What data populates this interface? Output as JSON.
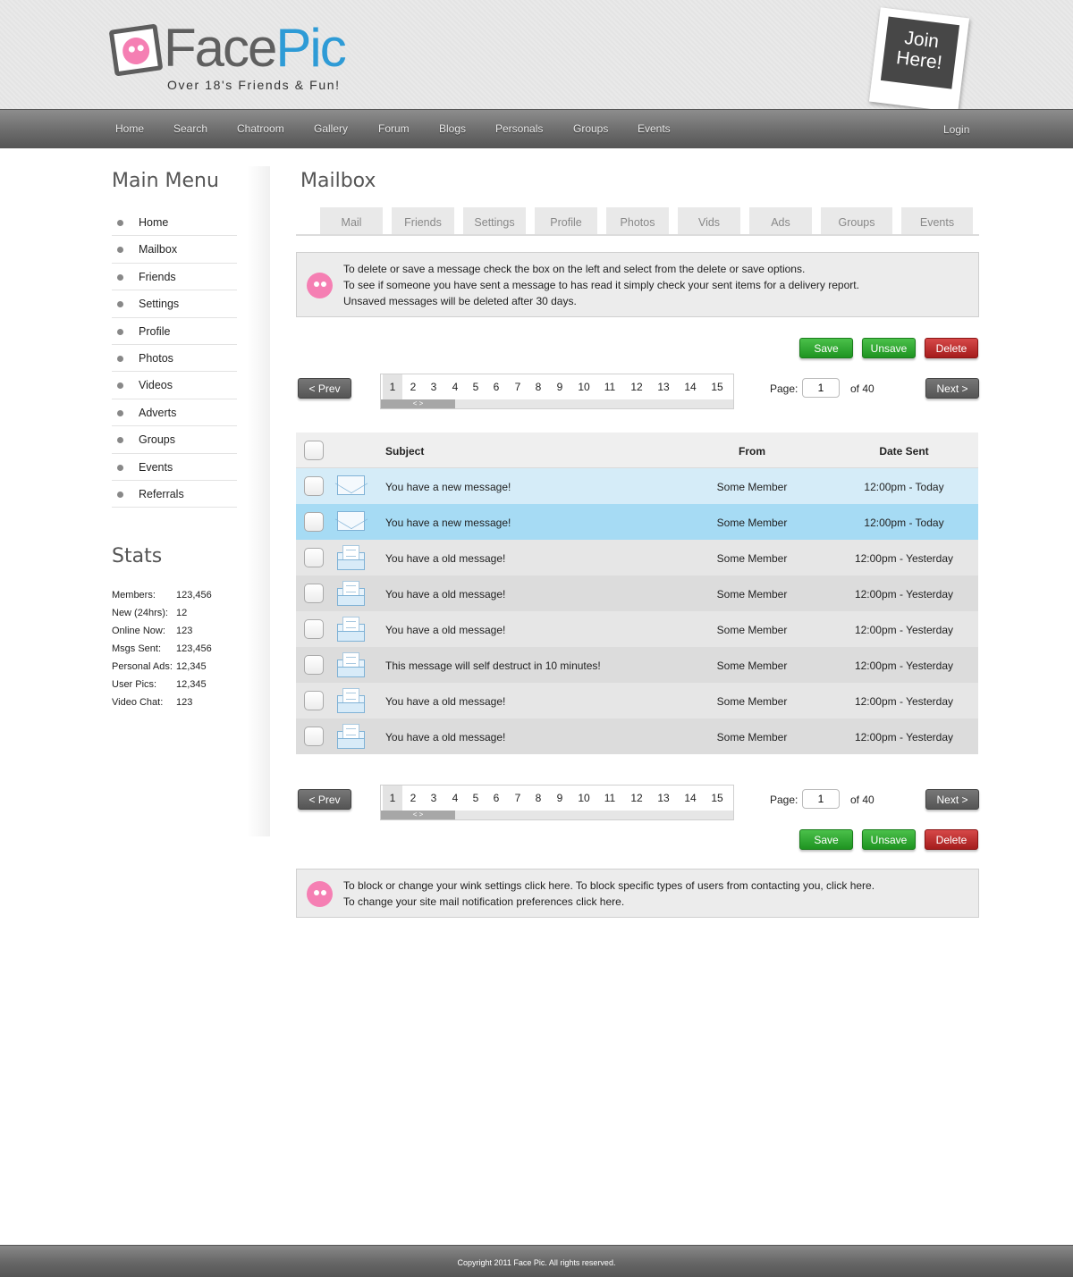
{
  "brand": {
    "name_part1": "Face",
    "name_part2": "Pic",
    "tagline": "Over 18's Friends & Fun!",
    "join_line1": "Join",
    "join_line2": "Here!",
    "pink": "#f57fb3",
    "blue": "#2e9bd6"
  },
  "nav": {
    "items": [
      "Home",
      "Search",
      "Chatroom",
      "Gallery",
      "Forum",
      "Blogs",
      "Personals",
      "Groups",
      "Events"
    ],
    "login": "Login"
  },
  "sidebar": {
    "menu_title": "Main Menu",
    "menu": [
      "Home",
      "Mailbox",
      "Friends",
      "Settings",
      "Profile",
      "Photos",
      "Videos",
      "Adverts",
      "Groups",
      "Events",
      "Referrals"
    ],
    "stats_title": "Stats",
    "stats": [
      {
        "label": "Members:",
        "value": "123,456"
      },
      {
        "label": "New (24hrs):",
        "value": "12"
      },
      {
        "label": "Online Now:",
        "value": "123"
      },
      {
        "label": "Msgs Sent:",
        "value": "123,456"
      },
      {
        "label": "Personal Ads:",
        "value": "12,345"
      },
      {
        "label": "User Pics:",
        "value": "12,345"
      },
      {
        "label": "Video Chat:",
        "value": "123"
      }
    ]
  },
  "main": {
    "title": "Mailbox",
    "tabs": [
      "Mail",
      "Friends",
      "Settings",
      "Profile",
      "Photos",
      "Vids",
      "Ads",
      "Groups",
      "Events"
    ],
    "info_top": [
      "To delete or save a message check the box on the left and select from the delete or save options.",
      "To see if someone you have sent a message to has read it simply check your sent items for a delivery report.",
      "Unsaved messages will be deleted after 30 days."
    ],
    "info_bottom": [
      "To block or change your wink settings click here. To block specific types of users from contacting you, click here.",
      "To change your site mail notification preferences click here."
    ],
    "buttons": {
      "save": "Save",
      "unsave": "Unsave",
      "delete": "Delete"
    },
    "pager": {
      "prev": "< Prev",
      "next": "Next >",
      "pages": [
        "1",
        "2",
        "3",
        "4",
        "5",
        "6",
        "7",
        "8",
        "9",
        "10",
        "11",
        "12",
        "13",
        "14",
        "15"
      ],
      "current": "1",
      "page_label": "Page:",
      "of_label": "of 40",
      "scroll_label": "< >"
    },
    "table": {
      "headers": {
        "subject": "Subject",
        "from": "From",
        "date": "Date Sent"
      },
      "rows": [
        {
          "subject": "You have a new message!",
          "from": "Some Member",
          "date": "12:00pm - Today",
          "state": "new"
        },
        {
          "subject": "You have a new message!",
          "from": "Some Member",
          "date": "12:00pm - Today",
          "state": "new-selected"
        },
        {
          "subject": "You have a old message!",
          "from": "Some Member",
          "date": "12:00pm - Yesterday",
          "state": "read"
        },
        {
          "subject": "You have a old message!",
          "from": "Some Member",
          "date": "12:00pm - Yesterday",
          "state": "read"
        },
        {
          "subject": "You have a old message!",
          "from": "Some Member",
          "date": "12:00pm - Yesterday",
          "state": "read"
        },
        {
          "subject": "This message will self destruct in 10 minutes!",
          "from": "Some Member",
          "date": "12:00pm - Yesterday",
          "state": "read"
        },
        {
          "subject": "You have a old message!",
          "from": "Some Member",
          "date": "12:00pm - Yesterday",
          "state": "read"
        },
        {
          "subject": "You have a old message!",
          "from": "Some Member",
          "date": "12:00pm - Yesterday",
          "state": "read"
        }
      ]
    }
  },
  "footer": {
    "copyright": "Copyright 2011 Face Pic. All rights reserved."
  }
}
